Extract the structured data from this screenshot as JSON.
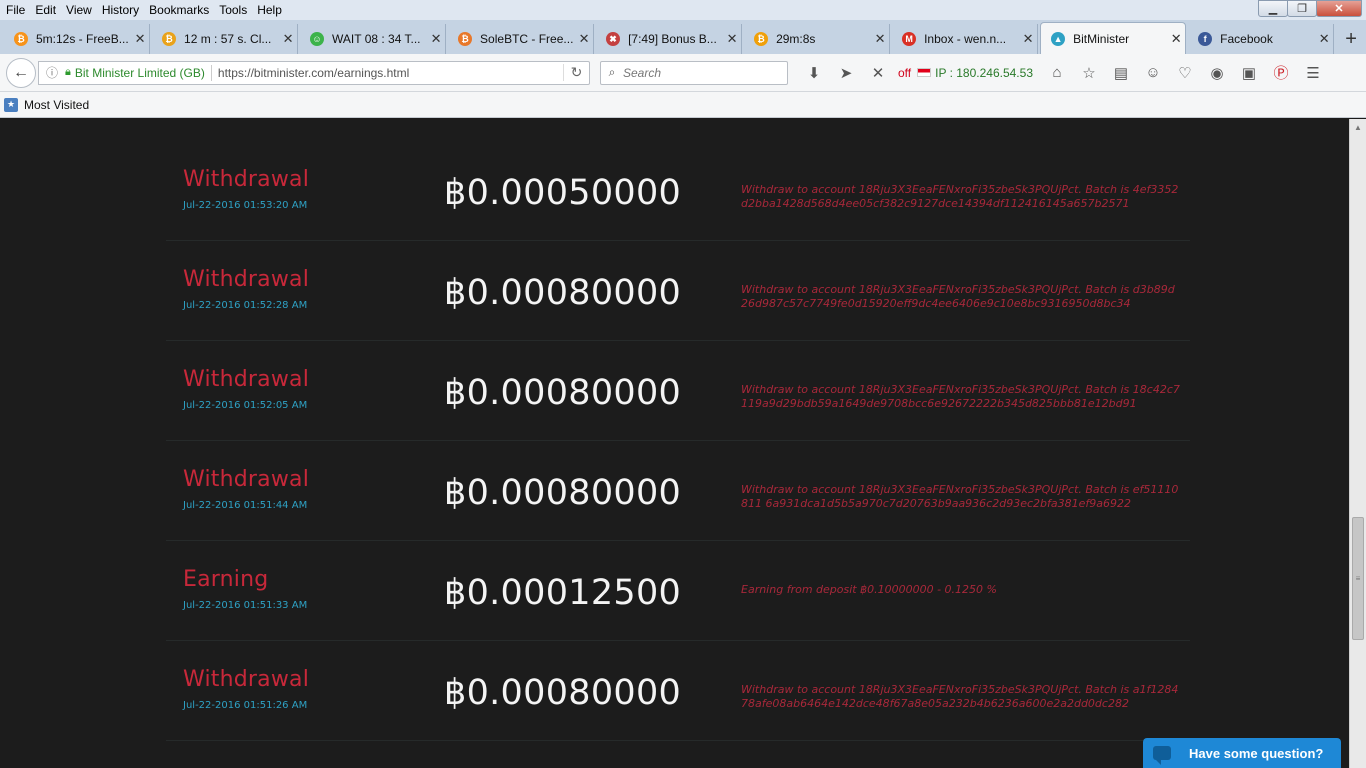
{
  "menu": [
    "File",
    "Edit",
    "View",
    "History",
    "Bookmarks",
    "Tools",
    "Help"
  ],
  "window_controls": {
    "minimize": "▁",
    "restore": "❐",
    "close": "✕"
  },
  "tabs": [
    {
      "label": "5m:12s - FreeB...",
      "icon_color": "#f7931a",
      "icon": "₿"
    },
    {
      "label": "12 m : 57 s. Cl...",
      "icon_color": "#e9a21a",
      "icon": "₿"
    },
    {
      "label": "WAIT 08 : 34 T...",
      "icon_color": "#3cb34a",
      "icon": "☺"
    },
    {
      "label": "SoleBTC - Free...",
      "icon_color": "#e8782a",
      "icon": "₿"
    },
    {
      "label": "[7:49] Bonus B...",
      "icon_color": "#c44040",
      "icon": "✖"
    },
    {
      "label": "29m:8s",
      "icon_color": "#f0a00a",
      "icon": "₿"
    },
    {
      "label": "Inbox - wen.n...",
      "icon_color": "#d93025",
      "icon": "M"
    },
    {
      "label": "BitMinister",
      "icon_color": "#2ea1c4",
      "icon": "▲"
    },
    {
      "label": "Facebook",
      "icon_color": "#3b5998",
      "icon": "f"
    }
  ],
  "active_tab": 7,
  "tab_close": "✕",
  "new_tab": "+",
  "address": {
    "identity": "Bit Minister Limited (GB)",
    "url": "https://bitminister.com/earnings.html"
  },
  "search": {
    "placeholder": "Search"
  },
  "ip": {
    "off": "off",
    "label": "IP : 180.246.54.53"
  },
  "bookmarks": {
    "most_visited": "Most Visited"
  },
  "transactions": [
    {
      "type": "Withdrawal",
      "date": "Jul-22-2016 01:53:20 AM",
      "amount": "฿0.00050000",
      "note": "Withdraw to account 18Rju3X3EeaFENxroFi35zbeSk3PQUjPct. Batch is 4ef3352d2bba1428d568d4ee05cf382c9127dce14394df112416145a657b2571"
    },
    {
      "type": "Withdrawal",
      "date": "Jul-22-2016 01:52:28 AM",
      "amount": "฿0.00080000",
      "note": "Withdraw to account 18Rju3X3EeaFENxroFi35zbeSk3PQUjPct. Batch is d3b89d26d987c57c7749fe0d15920eff9dc4ee6406e9c10e8bc9316950d8bc34"
    },
    {
      "type": "Withdrawal",
      "date": "Jul-22-2016 01:52:05 AM",
      "amount": "฿0.00080000",
      "note": "Withdraw to account 18Rju3X3EeaFENxroFi35zbeSk3PQUjPct. Batch is 18c42c7119a9d29bdb59a1649de9708bcc6e92672222b345d825bbb81e12bd91"
    },
    {
      "type": "Withdrawal",
      "date": "Jul-22-2016 01:51:44 AM",
      "amount": "฿0.00080000",
      "note": "Withdraw to account 18Rju3X3EeaFENxroFi35zbeSk3PQUjPct. Batch is ef51110811 6a931dca1d5b5a970c7d20763b9aa936c2d93ec2bfa381ef9a6922"
    },
    {
      "type": "Earning",
      "date": "Jul-22-2016 01:51:33 AM",
      "amount": "฿0.00012500",
      "note": "Earning from deposit ฿0.10000000 - 0.1250 %"
    },
    {
      "type": "Withdrawal",
      "date": "Jul-22-2016 01:51:26 AM",
      "amount": "฿0.00080000",
      "note": "Withdraw to account 18Rju3X3EeaFENxroFi35zbeSk3PQUjPct. Batch is a1f128478afe08ab6464e142dce48f67a8e05a232b4b6236a600e2a2dd0dc282"
    }
  ],
  "chat": {
    "label": "Have some question?"
  }
}
